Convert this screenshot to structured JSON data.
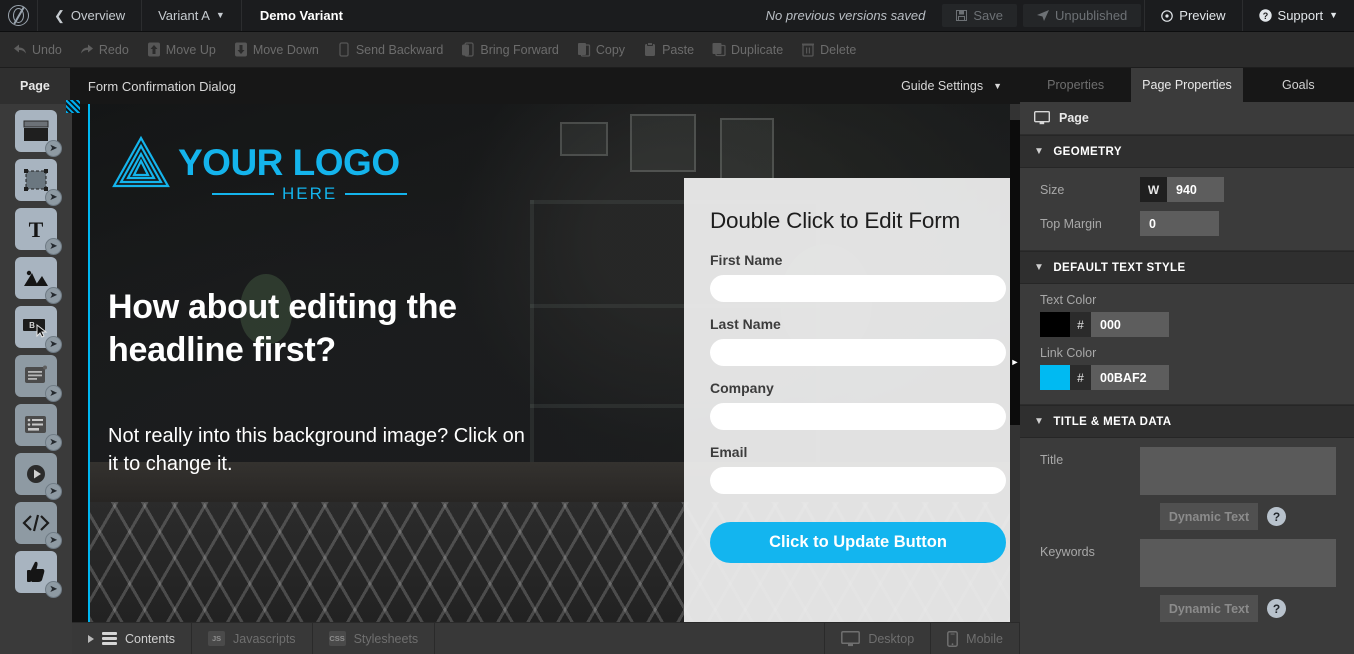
{
  "topbar": {
    "logo_icon": "leaf-circle-logo",
    "overview": "Overview",
    "variant": "Variant A",
    "title": "Demo Variant",
    "version_note": "No previous versions saved",
    "save": "Save",
    "unpublished": "Unpublished",
    "preview": "Preview",
    "support": "Support"
  },
  "edit_toolbar": {
    "items": [
      {
        "label": "Undo",
        "icon": "undo-arrow-icon"
      },
      {
        "label": "Redo",
        "icon": "redo-arrow-icon"
      },
      {
        "label": "Move Up",
        "icon": "arrow-up-icon"
      },
      {
        "label": "Move Down",
        "icon": "arrow-down-icon"
      },
      {
        "label": "Send Backward",
        "icon": "layer-back-icon"
      },
      {
        "label": "Bring Forward",
        "icon": "layer-front-icon"
      },
      {
        "label": "Copy",
        "icon": "copy-icon"
      },
      {
        "label": "Paste",
        "icon": "paste-icon"
      },
      {
        "label": "Duplicate",
        "icon": "duplicate-icon"
      },
      {
        "label": "Delete",
        "icon": "trash-icon"
      }
    ]
  },
  "canvas_tabs": {
    "page_tab": "Page",
    "dialog_tab": "Form Confirmation Dialog",
    "guide_settings": "Guide Settings"
  },
  "tool_rail": {
    "items": [
      {
        "name": "section-tool",
        "icon": "section-icon"
      },
      {
        "name": "box-tool",
        "icon": "dashed-box-icon"
      },
      {
        "name": "text-tool",
        "icon": "text-t-icon"
      },
      {
        "name": "image-tool",
        "icon": "image-mountain-icon"
      },
      {
        "name": "button-tool",
        "icon": "button-click-icon"
      },
      {
        "name": "form-tool",
        "icon": "form-lines-icon"
      },
      {
        "name": "list-tool",
        "icon": "list-rows-icon"
      },
      {
        "name": "video-tool",
        "icon": "play-circle-icon"
      },
      {
        "name": "code-tool",
        "icon": "code-brackets-icon"
      },
      {
        "name": "social-tool",
        "icon": "thumbs-up-icon"
      }
    ]
  },
  "hero": {
    "logo_main": "YOUR LOGO",
    "logo_sub": "HERE",
    "headline": "How about editing the headline first?",
    "subcopy": "Not really into this background image? Click on it to change it."
  },
  "form": {
    "title": "Double Click to Edit Form",
    "fields": [
      {
        "label": "First Name",
        "value": ""
      },
      {
        "label": "Last Name",
        "value": ""
      },
      {
        "label": "Company",
        "value": ""
      },
      {
        "label": "Email",
        "value": ""
      }
    ],
    "cta": "Click to Update Button",
    "cta_color": "#13B5EF"
  },
  "bottombar": {
    "contents": "Contents",
    "javascripts": "Javascripts",
    "javascripts_tag": "JS",
    "stylesheets": "Stylesheets",
    "stylesheets_tag": "CSS",
    "desktop": "Desktop",
    "mobile": "Mobile"
  },
  "rightpanel": {
    "tabs": [
      {
        "label": "Properties",
        "active": false
      },
      {
        "label": "Page Properties",
        "active": true
      },
      {
        "label": "Goals",
        "active": false
      }
    ],
    "header": "Page",
    "header_icon": "monitor-icon",
    "sections": {
      "geometry": {
        "title": "GEOMETRY",
        "size_label": "Size",
        "size_prefix": "W",
        "size_value": "940",
        "top_margin_label": "Top Margin",
        "top_margin_value": "0"
      },
      "default_text_style": {
        "title": "DEFAULT TEXT STYLE",
        "text_color_label": "Text Color",
        "text_color_hash": "#",
        "text_color_value": "000",
        "text_color_hex": "#000000",
        "link_color_label": "Link Color",
        "link_color_hash": "#",
        "link_color_value": "00BAF2",
        "link_color_hex": "#00BAF2"
      },
      "title_meta": {
        "title": "TITLE & META DATA",
        "title_label": "Title",
        "title_value": "",
        "title_dynamic": "Dynamic Text",
        "title_help": "?",
        "keywords_label": "Keywords",
        "keywords_value": "",
        "keywords_dynamic": "Dynamic Text",
        "keywords_help": "?"
      }
    }
  }
}
